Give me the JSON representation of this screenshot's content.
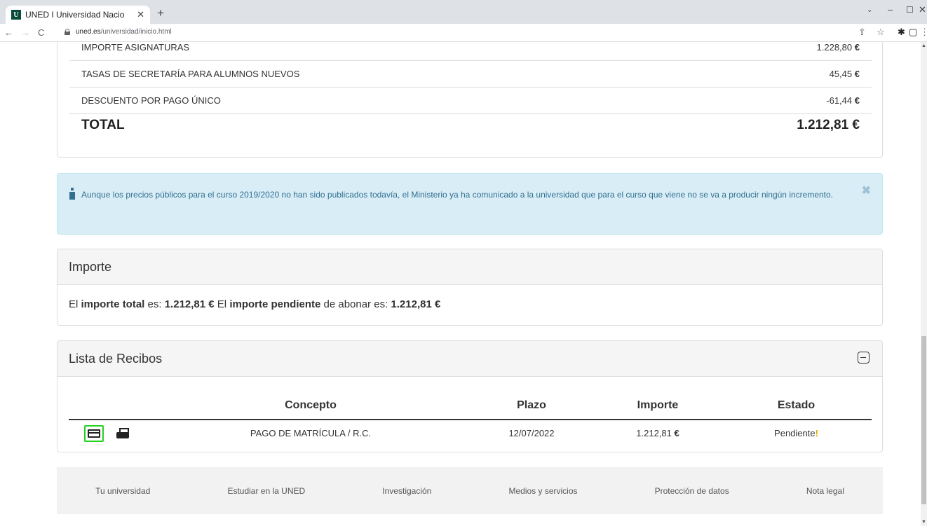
{
  "browser": {
    "tab_title": "UNED I Universidad Nacio",
    "favicon_letter": "U",
    "url_host": "uned.es",
    "url_path": "/universidad/inicio.html"
  },
  "summary": {
    "rows": [
      {
        "label": "IMPORTE ASIGNATURAS",
        "value": "1.228,80",
        "currency": "€"
      },
      {
        "label": "TASAS DE SECRETARÍA PARA ALUMNOS NUEVOS",
        "value": "45,45",
        "currency": "€"
      },
      {
        "label": "DESCUENTO POR PAGO ÚNICO",
        "value": "-61,44",
        "currency": "€"
      }
    ],
    "total_label": "TOTAL",
    "total_value": "1.212,81 €"
  },
  "alert": {
    "text": "Aunque los precios públicos para el curso 2019/2020 no han sido publicados todavía, el Ministerio ya ha comunicado a la universidad que para el curso que viene no se va a producir ningún incremento."
  },
  "importe": {
    "heading": "Importe",
    "p1": "El ",
    "b1": "importe total",
    "p2": " es: ",
    "b2": "1.212,81 €",
    "p3": " El ",
    "b3": "importe pendiente",
    "p4": " de abonar es: ",
    "b4": "1.212,81 €"
  },
  "recibos": {
    "heading": "Lista de Recibos",
    "columns": [
      "",
      "Concepto",
      "Plazo",
      "Importe",
      "Estado"
    ],
    "rows": [
      {
        "concepto": "PAGO DE MATRÍCULA / R.C.",
        "plazo": "12/07/2022",
        "importe": "1.212,81",
        "currency": "€",
        "estado": "Pendiente",
        "estado_mark": "!"
      }
    ]
  },
  "footer": {
    "links": [
      "Tu universidad",
      "Estudiar en la UNED",
      "Investigación",
      "Medios y servicios",
      "Protección de datos",
      "Nota legal"
    ]
  },
  "colors": {
    "alert_bg": "#d9edf7",
    "alert_text": "#31708f",
    "highlight": "#22d322",
    "warning": "#e0a800"
  }
}
